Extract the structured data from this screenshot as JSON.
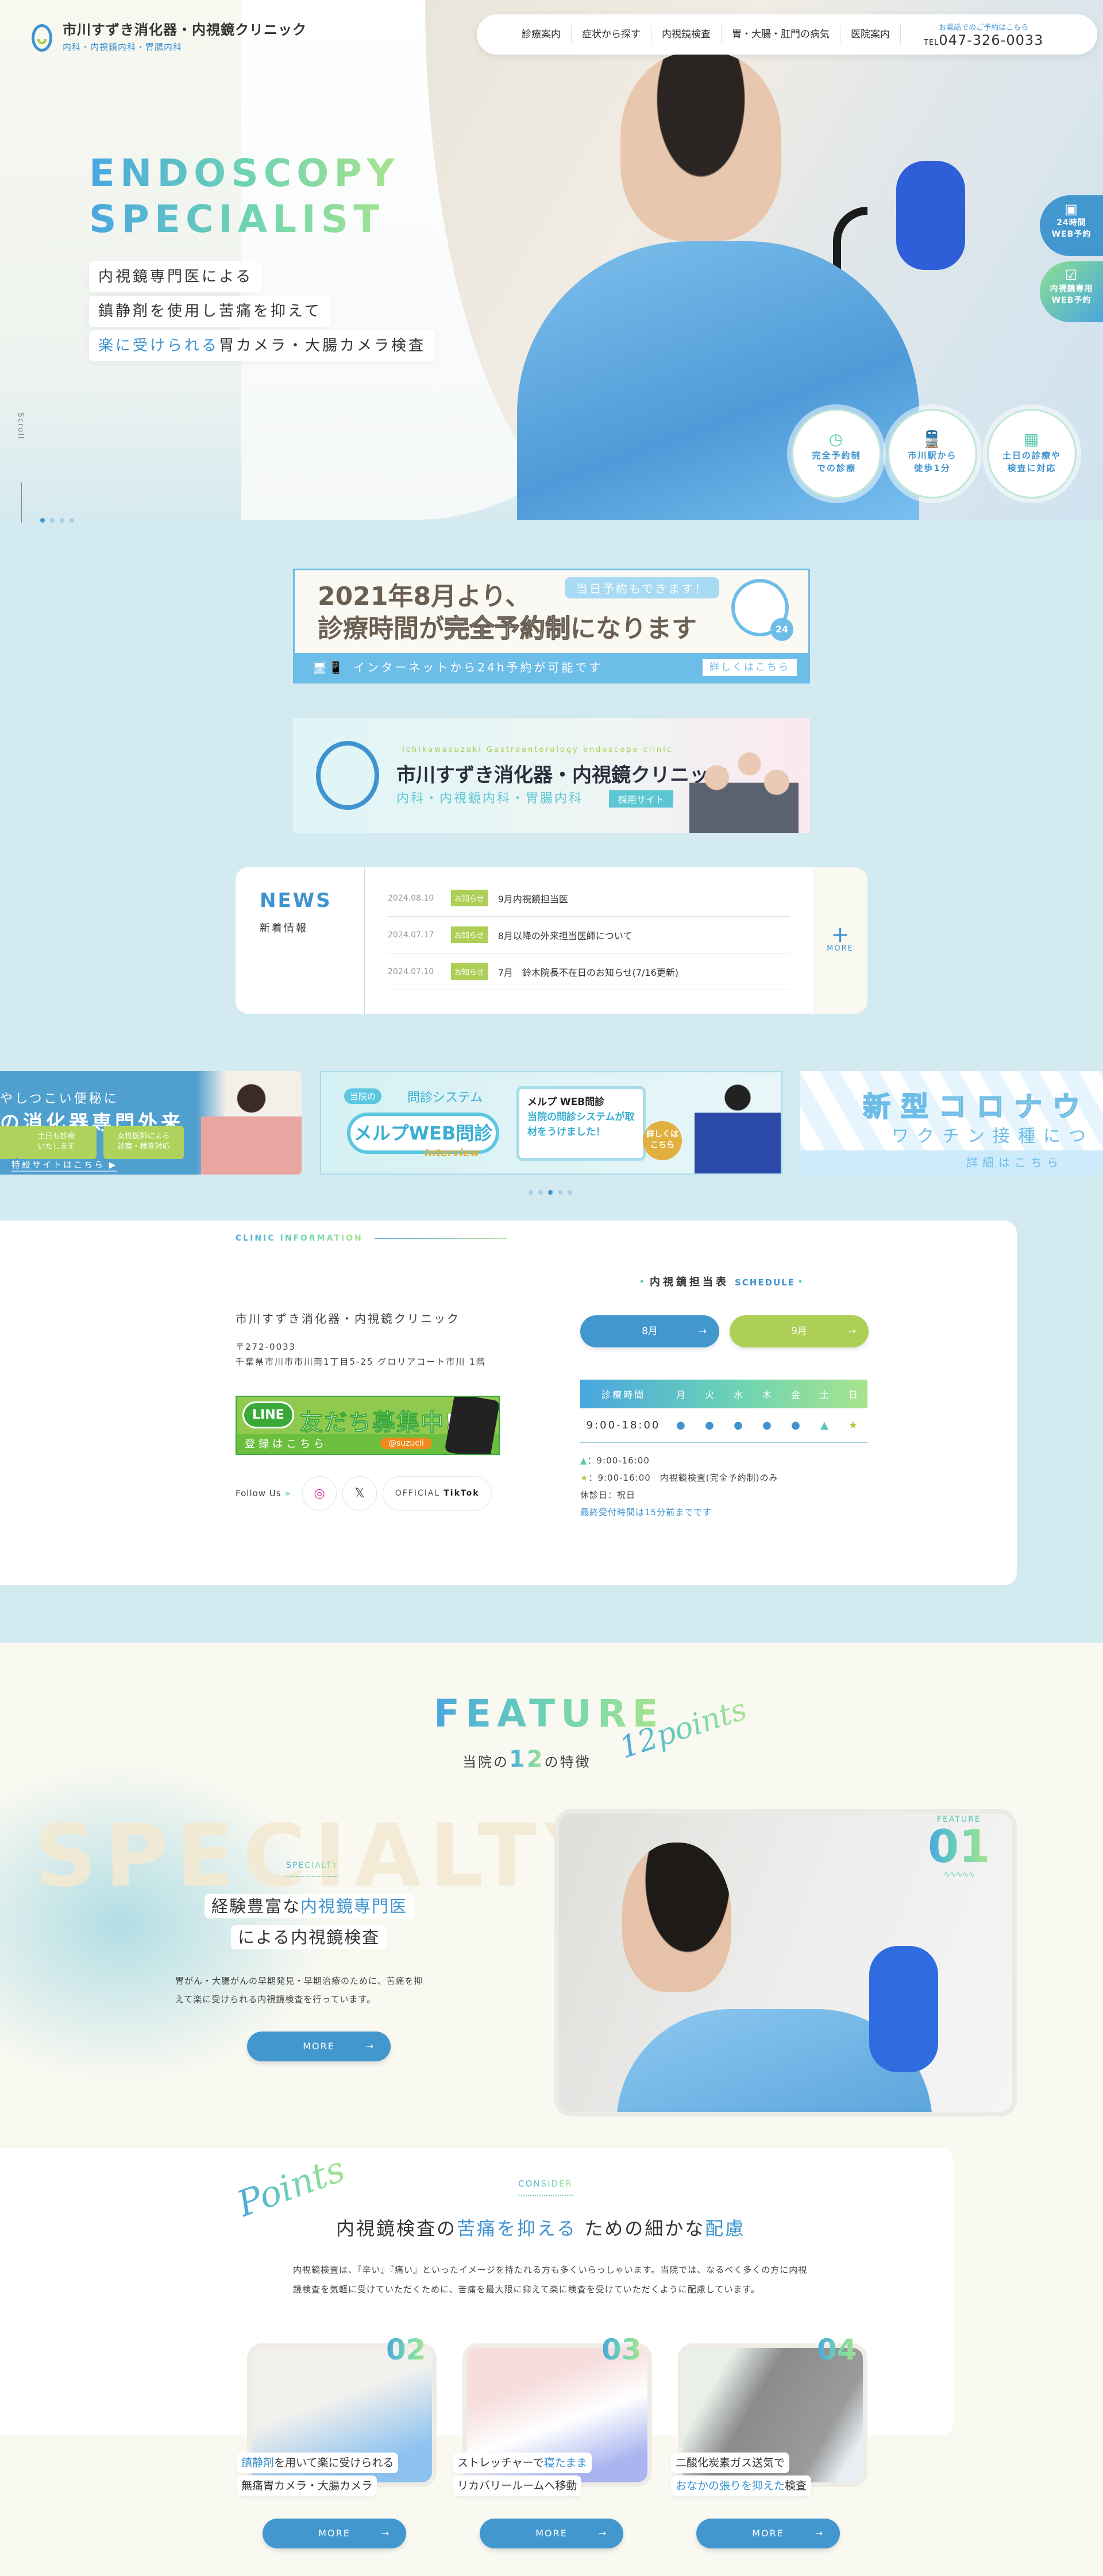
{
  "header": {
    "logo_name": "市川すずき消化器・内視鏡クリニック",
    "logo_sub": "内科・内視鏡内科・胃腸内科",
    "nav": [
      "診療案内",
      "症状から探す",
      "内視鏡検査",
      "胃・大腸・肛門の病気",
      "医院案内"
    ],
    "tel_label": "お電話でのご予約はこちら",
    "tel_prefix": "TEL",
    "tel_number": "047-326-0033"
  },
  "hero": {
    "title_line1": "ENDOSCOPY",
    "title_line2": "SPECIALIST",
    "tag1": "内視鏡専門医による",
    "tag2": "鎮静剤を使用し苦痛を抑えて",
    "tag3_highlight": "楽に受けられる",
    "tag3_rest": "胃カメラ・大腸カメラ検査",
    "side_buttons": [
      {
        "line1": "24時間",
        "line2": "WEB予約",
        "icon": "calendar-icon",
        "color": "#4397cf"
      },
      {
        "line1": "内視鏡専用",
        "line2": "WEB予約",
        "icon": "checklist-icon",
        "color": "#6dd3b4"
      }
    ],
    "circles": [
      {
        "line1": "完全予約制",
        "line2": "での診療",
        "icon": "clock-icon"
      },
      {
        "line1": "市川駅から",
        "line2": "徒歩1分",
        "icon": "train-icon"
      },
      {
        "line1": "土日の診療や",
        "line2": "検査に対応",
        "icon": "calendar-icon"
      }
    ],
    "scroll_label": "Scroll",
    "slide_count": 4,
    "active_slide": 1
  },
  "banners": {
    "reservation": {
      "line1": "2021年8月より、",
      "line2_pre": "診療時間が",
      "line2_hl": "完全予約制",
      "line2_post": "になります",
      "bubble": "当日予約もできます！",
      "clock_badge": "24",
      "bar_text": "インターネットから24h予約が可能です",
      "bar_button": "詳しくはこちら"
    },
    "recruit": {
      "en": "Ichikawasuzuki Gastroenterology endoscope clinic",
      "name": "市川すずき消化器・内視鏡クリニック",
      "sub": "内科・内視鏡内科・胃腸内科",
      "button": "採用サイト"
    }
  },
  "news": {
    "title_en": "NEWS",
    "title_ja": "新着情報",
    "items": [
      {
        "date": "2024.08.10",
        "badge": "お知らせ",
        "title": "9月内視鏡担当医"
      },
      {
        "date": "2024.07.17",
        "badge": "お知らせ",
        "title": "8月以降の外来担当医師について"
      },
      {
        "date": "2024.07.10",
        "badge": "お知らせ",
        "title": "7月　鈴木院長不在日のお知らせ(7/16更新)"
      }
    ],
    "more": "MORE"
  },
  "carousel": {
    "a": {
      "line1": "やしつこい便秘に",
      "line2": "の消化器専門外来",
      "chips": [
        "",
        "土日も診療\nいたします",
        "女性医師による\n診察・検査対応"
      ],
      "link": "特設サイトはこちら ▶"
    },
    "b": {
      "pill": "当院の",
      "system": "問診システム",
      "melp": "メルプWEB問診",
      "interview": "Interview",
      "card_logo": "メルプ WEB問診",
      "card_text": "当院の問診システムが取材をうけました！",
      "circle": "詳しくはこちら"
    },
    "c": {
      "line1": "新型コロナウ",
      "line2": "ワクチン接種につ",
      "bar": "詳細はこちら"
    },
    "slide_count": 5,
    "active_slide": 3
  },
  "clinic": {
    "label": "CLINIC INFORMATION",
    "name": "市川すずき消化器・内視鏡クリニック",
    "postal": "〒272-0033",
    "address": "千葉県市川市市川南1丁目5-25 グロリアコート市川 1階",
    "line_banner": {
      "logo": "LINE",
      "title": "友だち募集中!",
      "sub": "登録はこちら",
      "id": "@suzucli"
    },
    "follow_label": "Follow Us",
    "sns": [
      {
        "name": "instagram",
        "icon": "instagram-icon"
      },
      {
        "name": "x",
        "icon": "x-icon"
      }
    ],
    "tiktok_pre": "OFFICIAL",
    "tiktok": "TikTok"
  },
  "schedule": {
    "title": "内視鏡担当表",
    "title_en": "SCHEDULE",
    "months": [
      {
        "label": "8月",
        "color": "#4397cf"
      },
      {
        "label": "9月",
        "color": "#aecf55"
      }
    ],
    "header": [
      "診療時間",
      "月",
      "火",
      "水",
      "木",
      "金",
      "土",
      "日"
    ],
    "row": {
      "time": "9:00-18:00",
      "marks": [
        "●",
        "●",
        "●",
        "●",
        "●",
        "▲",
        "★"
      ]
    },
    "note_tri": "▲",
    "note_tri_text": "：9:00-16:00",
    "note_star": "★",
    "note_star_text": "：9:00-16:00　内視鏡検査(完全予約制)のみ",
    "holiday": "休診日：祝日",
    "last_reception": "最終受付時間は15分前までです"
  },
  "feature": {
    "title": "FEATURE",
    "script": "12points",
    "sub_pre": "当院の",
    "sub_num": "12",
    "sub_post": "の特徴",
    "watermark": "SPECIALTY",
    "specialty_label": "SPECIALTY",
    "heading1_pre": "経験豊富な",
    "heading1_hl": "内視鏡専門医",
    "heading2": "による内視鏡検査",
    "desc_line1": "胃がん・大腸がんの早期発見・早期治療のために、苦痛を抑",
    "desc_line2": "えて楽に受けられる内視鏡検査を行っています。",
    "more": "MORE",
    "badge_label": "FEATURE",
    "badge_num": "01"
  },
  "consider": {
    "script": "Points",
    "label": "CONSIDER",
    "title_pre": "内視鏡検査の",
    "title_hl1": "苦痛を抑える",
    "title_mid": " ための細かな",
    "title_hl2": "配慮",
    "desc": "内視鏡検査は、『辛い』『痛い』といったイメージを持たれる方も多くいらっしゃいます。当院では、なるべく多くの方に内視鏡検査を気軽に受けていただくために、苦痛を最大限に抑えて楽に検査を受けていただくように配慮しています。",
    "cards": [
      {
        "num": "02",
        "l1_hl": "鎮静剤",
        "l1": "を用いて楽に受けられる",
        "l2": "無痛胃カメラ・大腸カメラ",
        "l2_hl": "",
        "more": "MORE"
      },
      {
        "num": "03",
        "l1": "ストレッチャーで",
        "l1_hl": "寝たまま",
        "l2": "リカバリールームへ移動",
        "l2_hl": "",
        "more": "MORE"
      },
      {
        "num": "04",
        "l1": "二酸化炭素ガス送気で",
        "l1_hl": "",
        "l2_hl": "おなかの張りを抑えた",
        "l2": "検査",
        "more": "MORE"
      }
    ]
  },
  "colors": {
    "primary": "#4397cf",
    "green": "#aecf55",
    "teal": "#6dd3b4",
    "cream": "#f9f8f1",
    "light_blue": "#d3eaf1"
  }
}
